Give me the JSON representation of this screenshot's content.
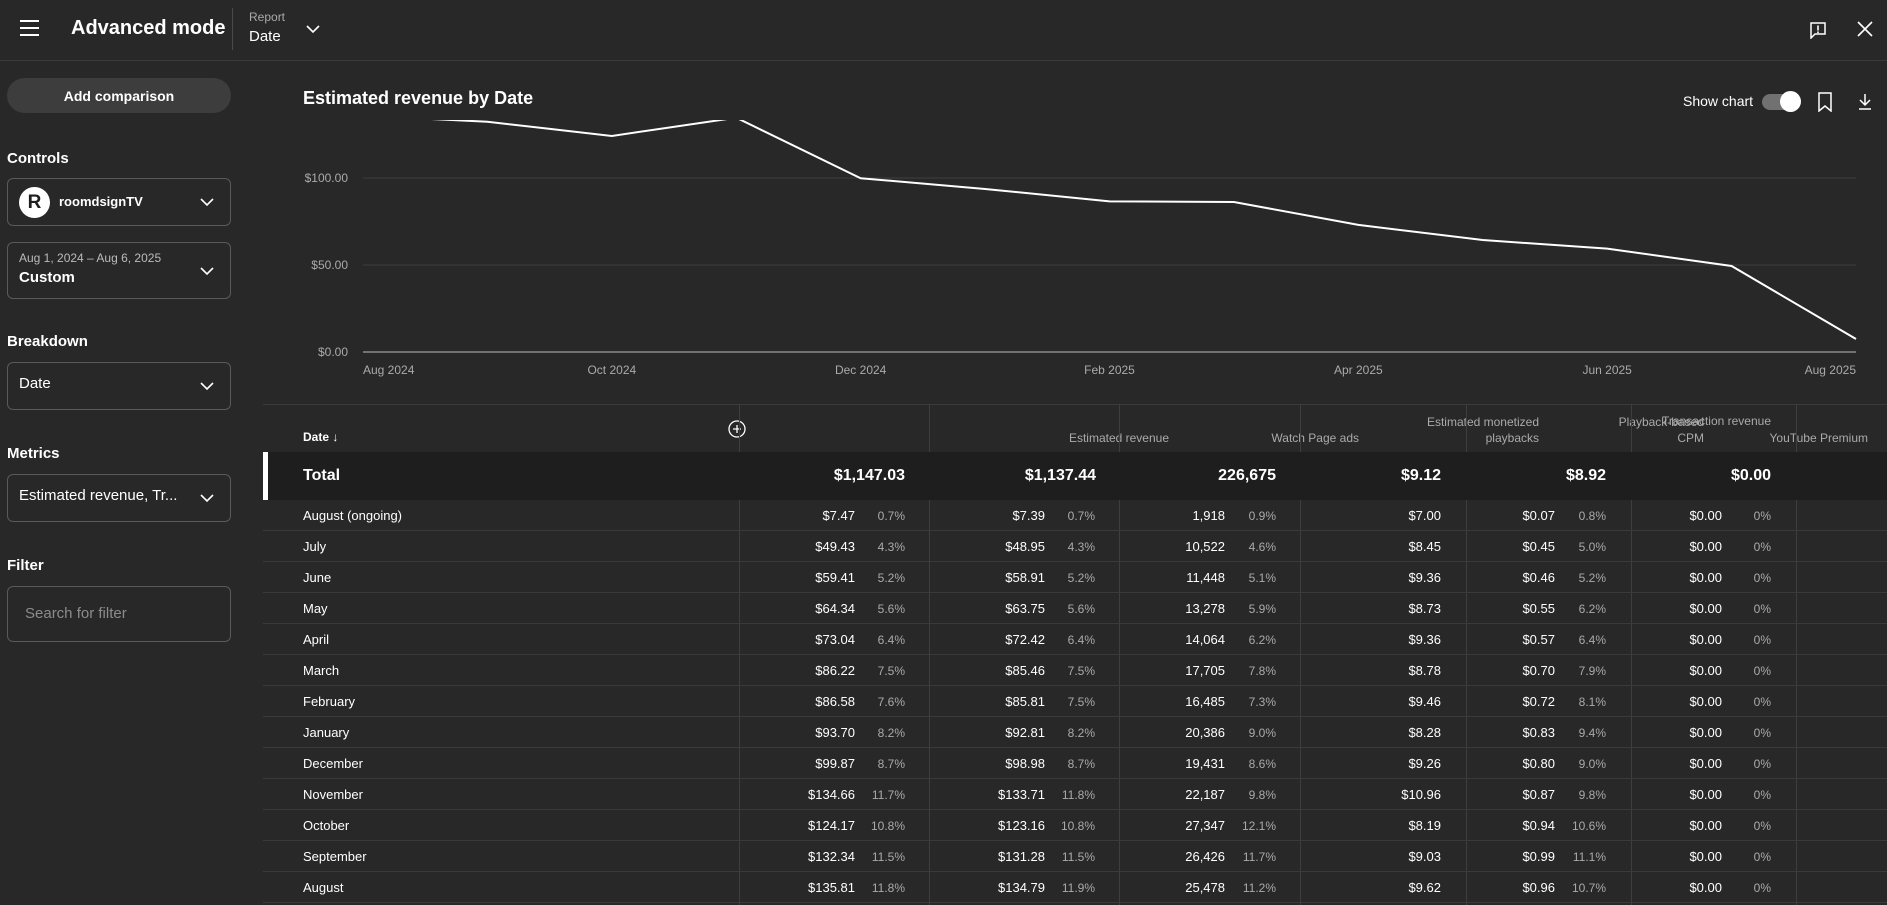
{
  "header": {
    "title": "Advanced mode",
    "report_label": "Report",
    "report_value": "Date"
  },
  "sidebar": {
    "add_comparison": "Add comparison",
    "controls_label": "Controls",
    "channel_name": "roomdsignTV",
    "avatar_letter": "R",
    "date_range": "Aug 1, 2024 – Aug 6, 2025",
    "date_preset": "Custom",
    "breakdown_label": "Breakdown",
    "breakdown_value": "Date",
    "metrics_label": "Metrics",
    "metrics_value": "Estimated revenue, Tr...",
    "filter_label": "Filter",
    "filter_placeholder": "Search for filter"
  },
  "chart": {
    "title": "Estimated revenue by Date",
    "show_chart_label": "Show chart",
    "show_chart_on": true
  },
  "chart_data": {
    "type": "line",
    "title": "Estimated revenue by Date",
    "x": [
      "Aug 2024",
      "Sep 2024",
      "Oct 2024",
      "Nov 2024",
      "Dec 2024",
      "Jan 2025",
      "Feb 2025",
      "Mar 2025",
      "Apr 2025",
      "May 2025",
      "Jun 2025",
      "Jul 2025",
      "Aug 2025"
    ],
    "values": [
      135.81,
      132.34,
      124.17,
      134.66,
      99.87,
      93.7,
      86.58,
      86.22,
      73.04,
      64.34,
      59.41,
      49.43,
      7.47
    ],
    "x_tick_labels": [
      "Aug 2024",
      "Oct 2024",
      "Dec 2024",
      "Feb 2025",
      "Apr 2025",
      "Jun 2025",
      "Aug 2025"
    ],
    "y_tick_labels": [
      "$100.00",
      "$50.00",
      "$0.00"
    ],
    "y_ticks": [
      100,
      50,
      0
    ],
    "ylim": [
      0,
      130
    ],
    "grid": true
  },
  "table": {
    "columns": [
      {
        "label": "Date"
      },
      {
        "label": "Estimated revenue"
      },
      {
        "label": "Watch Page ads"
      },
      {
        "label": "Estimated monetized playbacks"
      },
      {
        "label": "Playback-based CPM"
      },
      {
        "label": "YouTube Premium"
      },
      {
        "label": "Transaction revenue"
      }
    ],
    "total": {
      "label": "Total",
      "values": [
        "$1,147.03",
        "$1,137.44",
        "226,675",
        "$9.12",
        "$8.92",
        "$0.00"
      ]
    },
    "rows": [
      {
        "name": "August (ongoing)",
        "rev": "$7.47",
        "rev_pct": "0.7%",
        "wpa": "$7.39",
        "wpa_pct": "0.7%",
        "mp": "1,918",
        "mp_pct": "0.9%",
        "cpm": "$7.00",
        "yp": "$0.07",
        "yp_pct": "0.8%",
        "tr": "$0.00",
        "tr_pct": "0%"
      },
      {
        "name": "July",
        "rev": "$49.43",
        "rev_pct": "4.3%",
        "wpa": "$48.95",
        "wpa_pct": "4.3%",
        "mp": "10,522",
        "mp_pct": "4.6%",
        "cpm": "$8.45",
        "yp": "$0.45",
        "yp_pct": "5.0%",
        "tr": "$0.00",
        "tr_pct": "0%"
      },
      {
        "name": "June",
        "rev": "$59.41",
        "rev_pct": "5.2%",
        "wpa": "$58.91",
        "wpa_pct": "5.2%",
        "mp": "11,448",
        "mp_pct": "5.1%",
        "cpm": "$9.36",
        "yp": "$0.46",
        "yp_pct": "5.2%",
        "tr": "$0.00",
        "tr_pct": "0%"
      },
      {
        "name": "May",
        "rev": "$64.34",
        "rev_pct": "5.6%",
        "wpa": "$63.75",
        "wpa_pct": "5.6%",
        "mp": "13,278",
        "mp_pct": "5.9%",
        "cpm": "$8.73",
        "yp": "$0.55",
        "yp_pct": "6.2%",
        "tr": "$0.00",
        "tr_pct": "0%"
      },
      {
        "name": "April",
        "rev": "$73.04",
        "rev_pct": "6.4%",
        "wpa": "$72.42",
        "wpa_pct": "6.4%",
        "mp": "14,064",
        "mp_pct": "6.2%",
        "cpm": "$9.36",
        "yp": "$0.57",
        "yp_pct": "6.4%",
        "tr": "$0.00",
        "tr_pct": "0%"
      },
      {
        "name": "March",
        "rev": "$86.22",
        "rev_pct": "7.5%",
        "wpa": "$85.46",
        "wpa_pct": "7.5%",
        "mp": "17,705",
        "mp_pct": "7.8%",
        "cpm": "$8.78",
        "yp": "$0.70",
        "yp_pct": "7.9%",
        "tr": "$0.00",
        "tr_pct": "0%"
      },
      {
        "name": "February",
        "rev": "$86.58",
        "rev_pct": "7.6%",
        "wpa": "$85.81",
        "wpa_pct": "7.5%",
        "mp": "16,485",
        "mp_pct": "7.3%",
        "cpm": "$9.46",
        "yp": "$0.72",
        "yp_pct": "8.1%",
        "tr": "$0.00",
        "tr_pct": "0%"
      },
      {
        "name": "January",
        "rev": "$93.70",
        "rev_pct": "8.2%",
        "wpa": "$92.81",
        "wpa_pct": "8.2%",
        "mp": "20,386",
        "mp_pct": "9.0%",
        "cpm": "$8.28",
        "yp": "$0.83",
        "yp_pct": "9.4%",
        "tr": "$0.00",
        "tr_pct": "0%"
      },
      {
        "name": "December",
        "rev": "$99.87",
        "rev_pct": "8.7%",
        "wpa": "$98.98",
        "wpa_pct": "8.7%",
        "mp": "19,431",
        "mp_pct": "8.6%",
        "cpm": "$9.26",
        "yp": "$0.80",
        "yp_pct": "9.0%",
        "tr": "$0.00",
        "tr_pct": "0%"
      },
      {
        "name": "November",
        "rev": "$134.66",
        "rev_pct": "11.7%",
        "wpa": "$133.71",
        "wpa_pct": "11.8%",
        "mp": "22,187",
        "mp_pct": "9.8%",
        "cpm": "$10.96",
        "yp": "$0.87",
        "yp_pct": "9.8%",
        "tr": "$0.00",
        "tr_pct": "0%"
      },
      {
        "name": "October",
        "rev": "$124.17",
        "rev_pct": "10.8%",
        "wpa": "$123.16",
        "wpa_pct": "10.8%",
        "mp": "27,347",
        "mp_pct": "12.1%",
        "cpm": "$8.19",
        "yp": "$0.94",
        "yp_pct": "10.6%",
        "tr": "$0.00",
        "tr_pct": "0%"
      },
      {
        "name": "September",
        "rev": "$132.34",
        "rev_pct": "11.5%",
        "wpa": "$131.28",
        "wpa_pct": "11.5%",
        "mp": "26,426",
        "mp_pct": "11.7%",
        "cpm": "$9.03",
        "yp": "$0.99",
        "yp_pct": "11.1%",
        "tr": "$0.00",
        "tr_pct": "0%"
      },
      {
        "name": "August",
        "rev": "$135.81",
        "rev_pct": "11.8%",
        "wpa": "$134.79",
        "wpa_pct": "11.9%",
        "mp": "25,478",
        "mp_pct": "11.2%",
        "cpm": "$9.62",
        "yp": "$0.96",
        "yp_pct": "10.7%",
        "tr": "$0.00",
        "tr_pct": "0%"
      }
    ]
  },
  "icons": [
    "menu-icon",
    "chevron-down-icon",
    "feedback-icon",
    "close-icon",
    "bookmark-icon",
    "download-icon",
    "add-column-icon",
    "sort-arrow-icon"
  ]
}
